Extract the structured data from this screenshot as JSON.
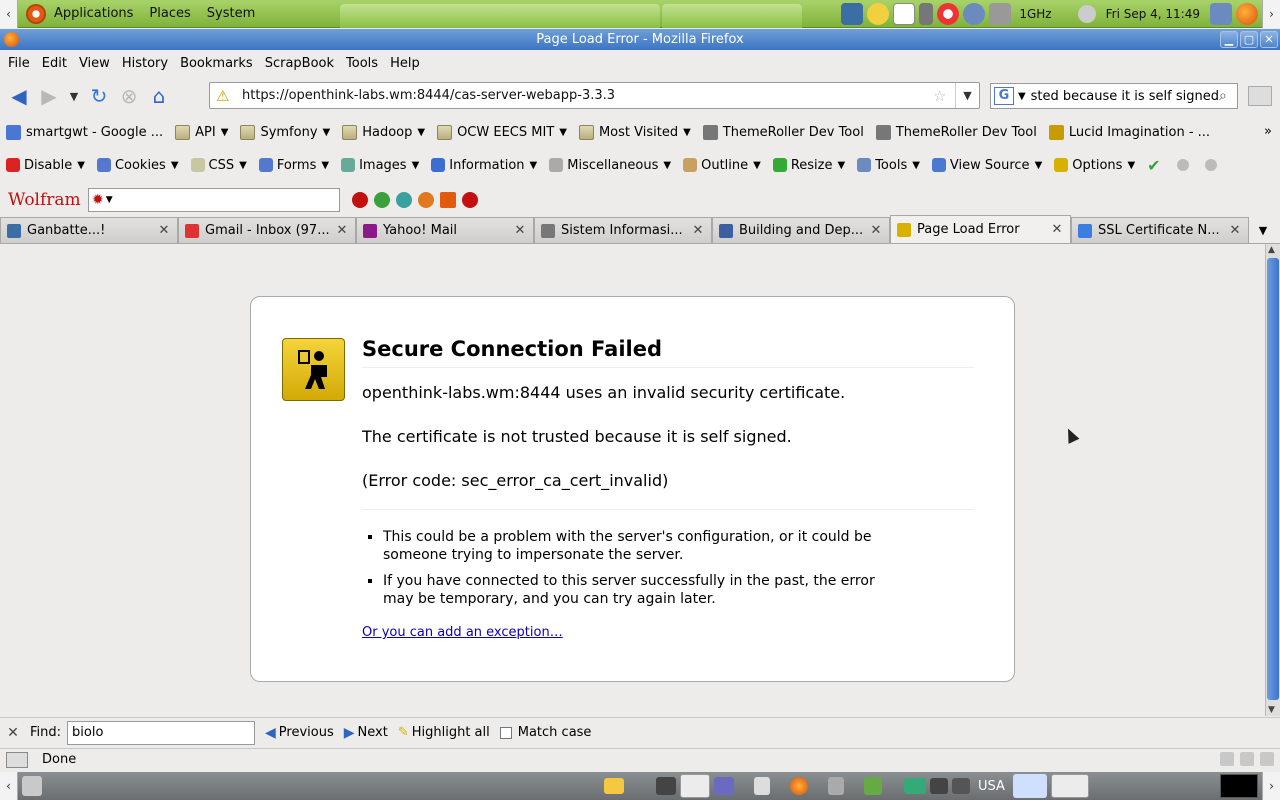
{
  "panel": {
    "menus": [
      "Applications",
      "Places",
      "System"
    ],
    "cpufreq": "1GHz",
    "clock": "Fri Sep  4, 11:49"
  },
  "window": {
    "title": "Page Load Error - Mozilla Firefox"
  },
  "menubar": [
    "File",
    "Edit",
    "View",
    "History",
    "Bookmarks",
    "ScrapBook",
    "Tools",
    "Help"
  ],
  "navbar": {
    "url": "https://openthink-labs.wm:8444/cas-server-webapp-3.3.3",
    "search_value": "The certificate is not trusted because it is self signed"
  },
  "bookmarks": [
    {
      "label": "smartgwt - Google ...",
      "folder": false,
      "color": "#4a77d4"
    },
    {
      "label": "API",
      "folder": true
    },
    {
      "label": "Symfony",
      "folder": true
    },
    {
      "label": "Hadoop",
      "folder": true
    },
    {
      "label": "OCW EECS MIT",
      "folder": true
    },
    {
      "label": "Most Visited",
      "folder": true
    },
    {
      "label": "ThemeRoller Dev Tool",
      "folder": false,
      "color": "#777"
    },
    {
      "label": "ThemeRoller Dev Tool",
      "folder": false,
      "color": "#777"
    },
    {
      "label": "Lucid Imagination - ...",
      "folder": false,
      "color": "#c89b00"
    }
  ],
  "bookmarks_more": "»",
  "webdev": [
    {
      "label": "Disable",
      "color": "#d22"
    },
    {
      "label": "Cookies",
      "color": "#5577cc"
    },
    {
      "label": "CSS",
      "color": "#c8c8a0"
    },
    {
      "label": "Forms",
      "color": "#5577cc"
    },
    {
      "label": "Images",
      "color": "#6a9"
    },
    {
      "label": "Information",
      "color": "#3a6fd0"
    },
    {
      "label": "Miscellaneous",
      "color": "#aaa"
    },
    {
      "label": "Outline",
      "color": "#c8a060"
    },
    {
      "label": "Resize",
      "color": "#3a3"
    },
    {
      "label": "Tools",
      "color": "#6a8ac0"
    },
    {
      "label": "View Source",
      "color": "#4a7ad0"
    },
    {
      "label": "Options",
      "color": "#d8b000"
    }
  ],
  "wolfram": {
    "logo": "Wolfram"
  },
  "tabs": [
    {
      "label": "Ganbatte...!",
      "width": 178,
      "color": "#3b6ea5",
      "active": false
    },
    {
      "label": "Gmail - Inbox (97...",
      "width": 178,
      "color": "#d33",
      "active": false
    },
    {
      "label": "Yahoo! Mail",
      "width": 178,
      "color": "#8a1a8a",
      "active": false
    },
    {
      "label": "Sistem Informasi...",
      "width": 178,
      "color": "#777",
      "active": false
    },
    {
      "label": "Building and Dep...",
      "width": 178,
      "color": "#3b5fa0",
      "active": false
    },
    {
      "label": "Page Load Error",
      "width": 181,
      "color": "#d8b000",
      "active": true
    },
    {
      "label": "SSL Certificate N...",
      "width": 178,
      "color": "#3b7de0",
      "active": false
    }
  ],
  "error": {
    "title": "Secure Connection Failed",
    "p1": "openthink-labs.wm:8444 uses an invalid security certificate.",
    "p2": "The certificate is not trusted because it is self signed.",
    "p3": "(Error code: sec_error_ca_cert_invalid)",
    "bullets": [
      "This could be a problem with the server's configuration, or it could be someone trying to impersonate the server.",
      "If you have connected to this server successfully in the past, the error may be temporary, and you can try again later."
    ],
    "link": "Or you can add an exception…"
  },
  "findbar": {
    "label": "Find:",
    "value": "biolo",
    "previous": "Previous",
    "next": "Next",
    "highlight": "Highlight all",
    "match_case": "Match case"
  },
  "status": {
    "text": "Done"
  },
  "taskbar": {
    "lang": "USA"
  }
}
